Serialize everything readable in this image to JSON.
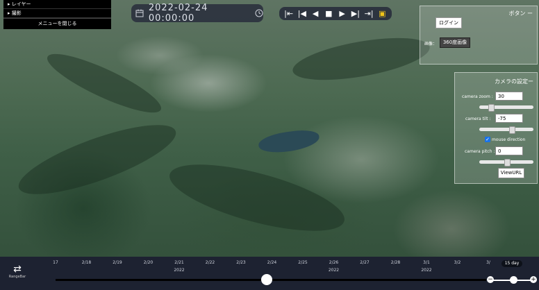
{
  "menu": {
    "items": [
      {
        "label": "▸ レイヤー"
      },
      {
        "label": "▸ 撮影"
      }
    ],
    "close_label": "メニューを閉じる"
  },
  "datetime": {
    "value": "2022-02-24 00:00:00"
  },
  "playback": {
    "buttons": [
      "go-to-start",
      "step-back",
      "play-reverse",
      "stop",
      "play-forward",
      "step-forward",
      "go-to-end",
      "settings"
    ]
  },
  "button_panel": {
    "title": "ボタン ー",
    "login_label": "ログイン",
    "image_label": "画像：",
    "image360_label": "360度画像"
  },
  "camera_panel": {
    "title": "カメラの設定ー",
    "zoom_label": "camera zoom :",
    "zoom_value": "30",
    "zoom_level": 0.18,
    "tilt_label": "camera tilt :",
    "tilt_value": "-75",
    "tilt_level": 0.6,
    "mouse_direction_label": "mouse direction",
    "mouse_direction_checked": true,
    "pitch_label": "camera pitch :",
    "pitch_value": "0",
    "pitch_level": 0.5,
    "viewurl_label": "ViewURL"
  },
  "timeline": {
    "rangebar_label": "RangeBar",
    "dates": [
      "17",
      "2/18",
      "2/19",
      "2/20",
      "2/21",
      "2/22",
      "2/23",
      "2/24",
      "2/25",
      "2/26",
      "2/27",
      "2/28",
      "3/1",
      "3/2",
      "3/"
    ],
    "years": [
      {
        "label": "2022",
        "after": "2/21"
      },
      {
        "label": "2022",
        "after": "2/26"
      },
      {
        "label": "2022",
        "after": "3/1"
      }
    ],
    "span_label": "15 day",
    "position": 0.49,
    "zoom_level": 0.5
  },
  "colors": {
    "accent": "#f0c419",
    "panel_bg": "#1d2231",
    "check": "#1a73e8"
  }
}
